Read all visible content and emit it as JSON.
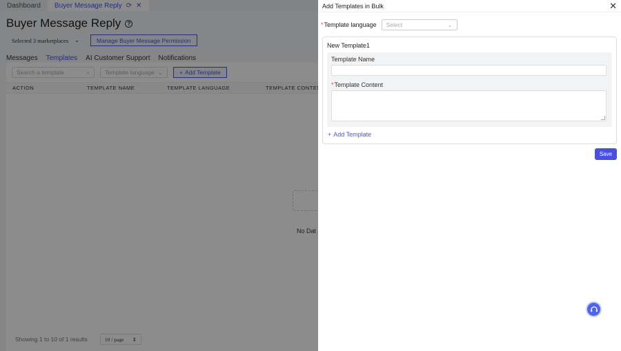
{
  "app": {
    "tabs": [
      {
        "label": "Dashboard"
      },
      {
        "label": "Buyer Message Reply"
      }
    ],
    "page_title": "Buyer Message Reply",
    "marketplace_select": "Selected 3 marketplaces",
    "permission_button": "Manage Buyer Message Permission",
    "subtabs": [
      {
        "label": "Messages"
      },
      {
        "label": "Templates"
      },
      {
        "label": "AI Customer Support"
      },
      {
        "label": "Notifications"
      }
    ],
    "search_placeholder": "Search a template",
    "language_placeholder": "Template language",
    "add_template_button": "Add Template",
    "columns": [
      "ACTION",
      "TEMPLATE NAME",
      "TEMPLATE LANGUAGE",
      "TEMPLATE CONTENT"
    ],
    "empty_text": "No Dat",
    "footer_text": "Showing 1 to 10 of 1 results",
    "page_size": "10 / page"
  },
  "drawer": {
    "title": "Add Templates in Bulk",
    "language_label": "Template language",
    "language_placeholder": "Select",
    "card_title": "New Template1",
    "name_label": "Template Name",
    "content_label": "Template Content",
    "add_link": "Add Template",
    "save_button": "Save"
  },
  "colors": {
    "accent": "#4a4fe0",
    "required": "#e24b4b"
  }
}
